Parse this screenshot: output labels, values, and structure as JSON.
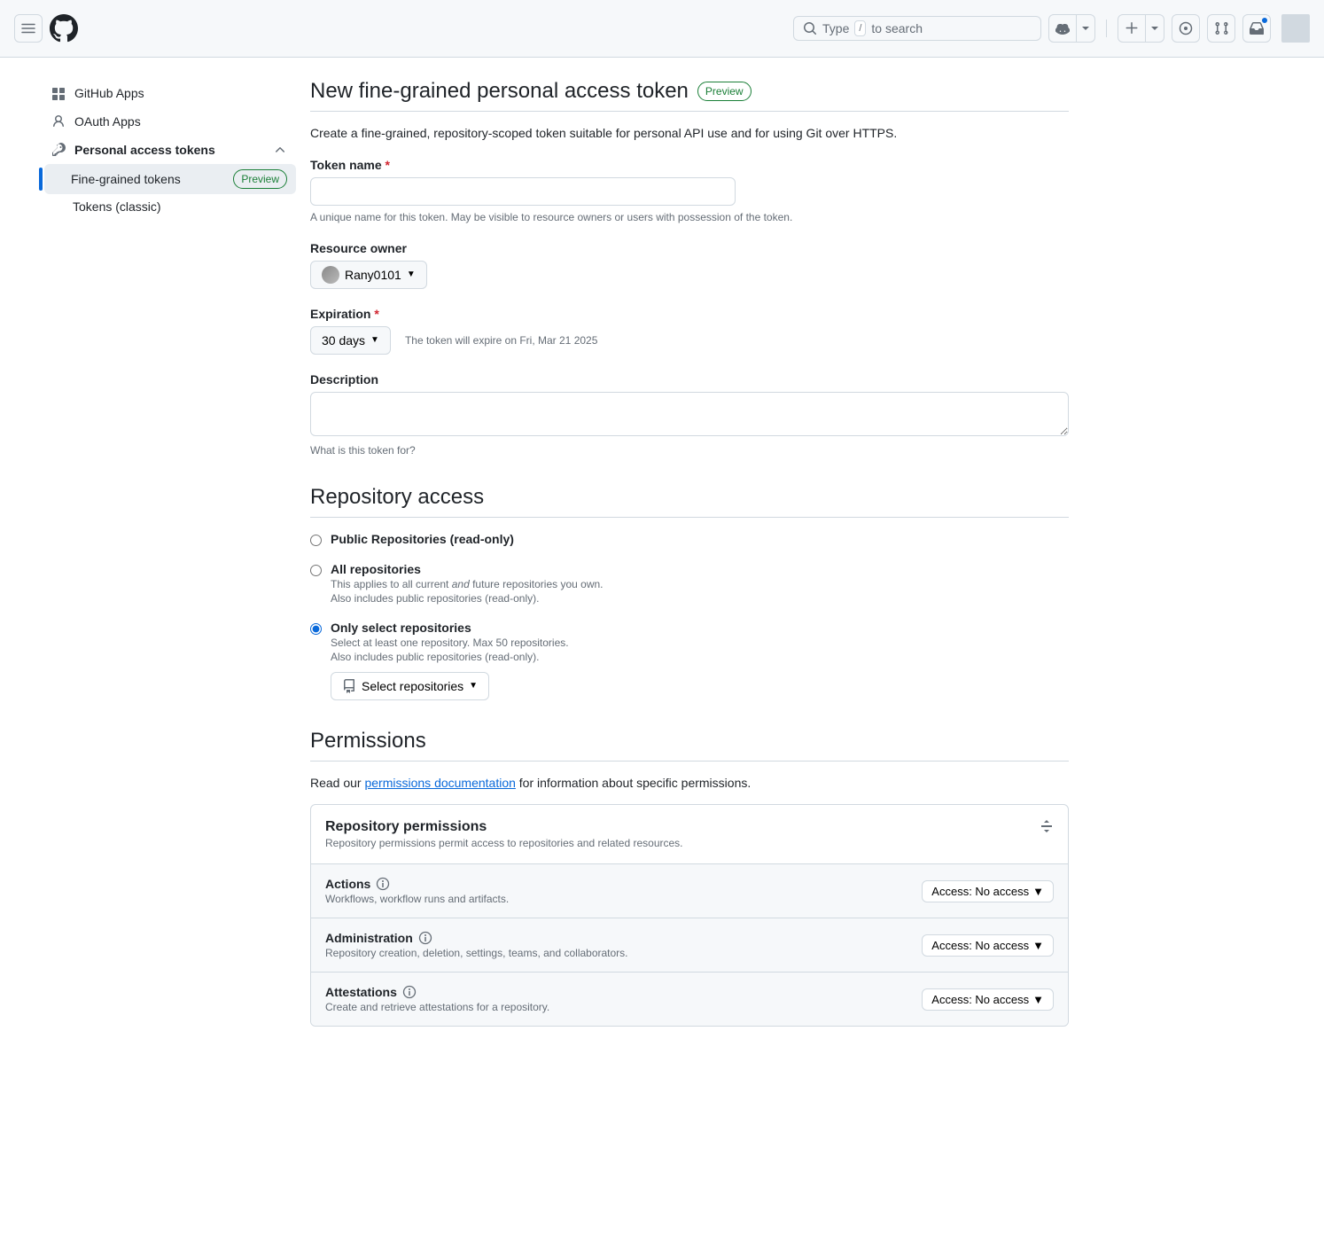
{
  "header": {
    "search_prefix": "Type",
    "search_key": "/",
    "search_suffix": "to search"
  },
  "sidebar": {
    "items": [
      {
        "label": "GitHub Apps"
      },
      {
        "label": "OAuth Apps"
      },
      {
        "label": "Personal access tokens"
      }
    ],
    "subitems": [
      {
        "label": "Fine-grained tokens",
        "badge": "Preview"
      },
      {
        "label": "Tokens (classic)"
      }
    ]
  },
  "page": {
    "title": "New fine-grained personal access token",
    "title_badge": "Preview",
    "intro": "Create a fine-grained, repository-scoped token suitable for personal API use and for using Git over HTTPS."
  },
  "form": {
    "token_name": {
      "label": "Token name",
      "value": "",
      "note": "A unique name for this token. May be visible to resource owners or users with possession of the token."
    },
    "resource_owner": {
      "label": "Resource owner",
      "value": "Rany0101"
    },
    "expiration": {
      "label": "Expiration",
      "value": "30 days",
      "note": "The token will expire on Fri, Mar 21 2025"
    },
    "description": {
      "label": "Description",
      "value": "",
      "note": "What is this token for?"
    }
  },
  "repo_access": {
    "heading": "Repository access",
    "options": [
      {
        "label": "Public Repositories (read-only)"
      },
      {
        "label": "All repositories",
        "desc1_a": "This applies to all current ",
        "desc1_em": "and",
        "desc1_b": " future repositories you own.",
        "desc2": "Also includes public repositories (read-only)."
      },
      {
        "label": "Only select repositories",
        "desc1": "Select at least one repository. Max 50 repositories.",
        "desc2": "Also includes public repositories (read-only)."
      }
    ],
    "select_repos_btn": "Select repositories"
  },
  "permissions": {
    "heading": "Permissions",
    "blurb_a": "Read our ",
    "blurb_link": "permissions documentation",
    "blurb_b": " for information about specific permissions.",
    "section_title": "Repository permissions",
    "section_desc": "Repository permissions permit access to repositories and related resources.",
    "rows": [
      {
        "name": "Actions",
        "desc": "Workflows, workflow runs and artifacts.",
        "access": "Access: No access"
      },
      {
        "name": "Administration",
        "desc": "Repository creation, deletion, settings, teams, and collaborators.",
        "access": "Access: No access"
      },
      {
        "name": "Attestations",
        "desc": "Create and retrieve attestations for a repository.",
        "access": "Access: No access"
      }
    ]
  }
}
